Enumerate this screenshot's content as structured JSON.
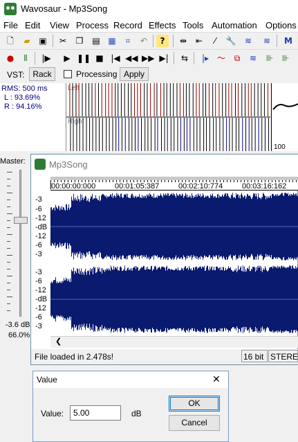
{
  "window": {
    "title": "Wavosaur - Mp3Song"
  },
  "menu": [
    "File",
    "Edit",
    "View",
    "Process",
    "Record",
    "Effects",
    "Tools",
    "Automation",
    "Options"
  ],
  "vst": {
    "label": "VST:",
    "rack": "Rack",
    "processing": "Processing",
    "processing_checked": false,
    "apply": "Apply"
  },
  "monitor": {
    "rms": "RMS: 500 ms",
    "left_pct": "L : 93.69%",
    "right_pct": "R : 94.16%",
    "left_channel": "Left",
    "right_channel": "Right",
    "scale_max": "100"
  },
  "master": {
    "label": "Master:",
    "db": "-3.6 dB",
    "pct": "66.0%",
    "level": 0.66
  },
  "document": {
    "title": "Mp3Song",
    "timeline": [
      "00:00:00:000",
      "00:01:05:387",
      "00:02:10:774",
      "00:03:16:162"
    ],
    "scale_top": [
      "-3",
      "-6",
      "-12",
      "-dB",
      "-12",
      "-6",
      "-3"
    ],
    "scale_bottom": [
      "-3",
      "-6",
      "-12",
      "-dB",
      "-12",
      "-6",
      "-3"
    ],
    "status": "File loaded in 2.478s!",
    "bit_depth": "16 bit",
    "channels": "STEREO",
    "wave_color": "#0a1a6e"
  },
  "dialog": {
    "title": "Value",
    "value_label": "Value:",
    "value": "5.00",
    "unit": "dB",
    "ok": "OK",
    "cancel": "Cancel"
  }
}
